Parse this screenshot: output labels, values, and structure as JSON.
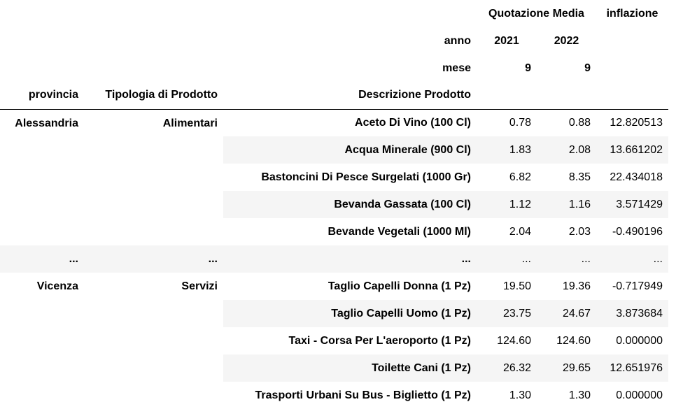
{
  "header": {
    "col_group": "Quotazione Media",
    "col_inflazione": "inflazione",
    "anno_label": "anno",
    "mese_label": "mese",
    "years": [
      "2021",
      "2022"
    ],
    "months": [
      "9",
      "9"
    ],
    "index_names": [
      "provincia",
      "Tipologia di Prodotto",
      "Descrizione Prodotto"
    ]
  },
  "rows": [
    {
      "provincia": "Alessandria",
      "tipologia": "Alimentari",
      "descrizione": "Aceto Di Vino (100 Cl)",
      "v2021": "0.78",
      "v2022": "0.88",
      "inflazione": "12.820513"
    },
    {
      "provincia": "",
      "tipologia": "",
      "descrizione": "Acqua Minerale (900 Cl)",
      "v2021": "1.83",
      "v2022": "2.08",
      "inflazione": "13.661202"
    },
    {
      "provincia": "",
      "tipologia": "",
      "descrizione": "Bastoncini Di Pesce Surgelati (1000 Gr)",
      "v2021": "6.82",
      "v2022": "8.35",
      "inflazione": "22.434018"
    },
    {
      "provincia": "",
      "tipologia": "",
      "descrizione": "Bevanda Gassata (100 Cl)",
      "v2021": "1.12",
      "v2022": "1.16",
      "inflazione": "3.571429"
    },
    {
      "provincia": "",
      "tipologia": "",
      "descrizione": "Bevande Vegetali (1000 Ml)",
      "v2021": "2.04",
      "v2022": "2.03",
      "inflazione": "-0.490196"
    },
    {
      "provincia": "...",
      "tipologia": "...",
      "descrizione": "...",
      "v2021": "...",
      "v2022": "...",
      "inflazione": "..."
    },
    {
      "provincia": "Vicenza",
      "tipologia": "Servizi",
      "descrizione": "Taglio Capelli Donna (1 Pz)",
      "v2021": "19.50",
      "v2022": "19.36",
      "inflazione": "-0.717949"
    },
    {
      "provincia": "",
      "tipologia": "",
      "descrizione": "Taglio Capelli Uomo (1 Pz)",
      "v2021": "23.75",
      "v2022": "24.67",
      "inflazione": "3.873684"
    },
    {
      "provincia": "",
      "tipologia": "",
      "descrizione": "Taxi - Corsa Per L'aeroporto (1 Pz)",
      "v2021": "124.60",
      "v2022": "124.60",
      "inflazione": "0.000000"
    },
    {
      "provincia": "",
      "tipologia": "",
      "descrizione": "Toilette Cani (1 Pz)",
      "v2021": "26.32",
      "v2022": "29.65",
      "inflazione": "12.651976"
    },
    {
      "provincia": "",
      "tipologia": "",
      "descrizione": "Trasporti Urbani Su Bus - Biglietto (1 Pz)",
      "v2021": "1.30",
      "v2022": "1.30",
      "inflazione": "0.000000"
    }
  ]
}
